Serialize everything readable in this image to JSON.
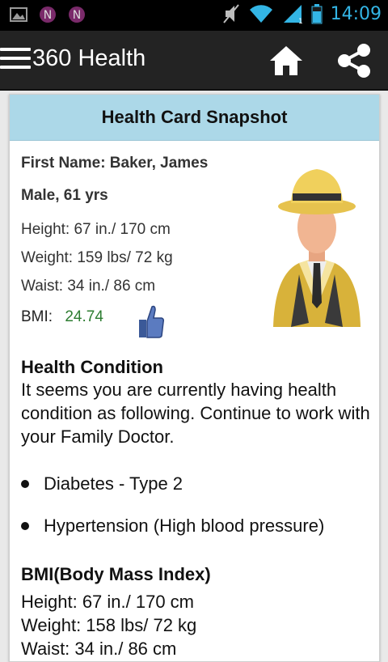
{
  "status_bar": {
    "time": "14:09",
    "icons": [
      "image-icon",
      "n-notification-icon",
      "n-notification-icon",
      "mute-icon",
      "wifi-icon",
      "signal-icon",
      "battery-icon"
    ]
  },
  "action_bar": {
    "title": "360 Health",
    "menu_icon": "hamburger-icon",
    "home_icon": "home-icon",
    "share_icon": "share-icon"
  },
  "card": {
    "header": "Health Card Snapshot",
    "name": "First Name: Baker, James",
    "sex_age": "Male, 61 yrs",
    "height": "Height: 67 in./ 170 cm",
    "weight": "Weight: 159 lbs/ 72 kg",
    "waist": "Waist: 34 in./ 86 cm",
    "bmi_label": "BMI:",
    "bmi_value": "24.74",
    "bmi_color": "#2e7d32"
  },
  "health_condition": {
    "title": "Health Condition",
    "text": "It seems you are currently having health condition as following. Continue to work with your Family Doctor.",
    "items": [
      "Diabetes - Type 2",
      "Hypertension (High blood pressure)"
    ]
  },
  "bmi_section": {
    "title": "BMI(Body Mass Index)",
    "height": "Height: 67 in./ 170 cm",
    "weight": "Weight: 158 lbs/ 72 kg",
    "waist": "Waist: 34 in./ 86 cm"
  },
  "colors": {
    "status_accent": "#33b5e5",
    "header_bg": "#acd8e8",
    "action_bar_bg": "#232323"
  }
}
